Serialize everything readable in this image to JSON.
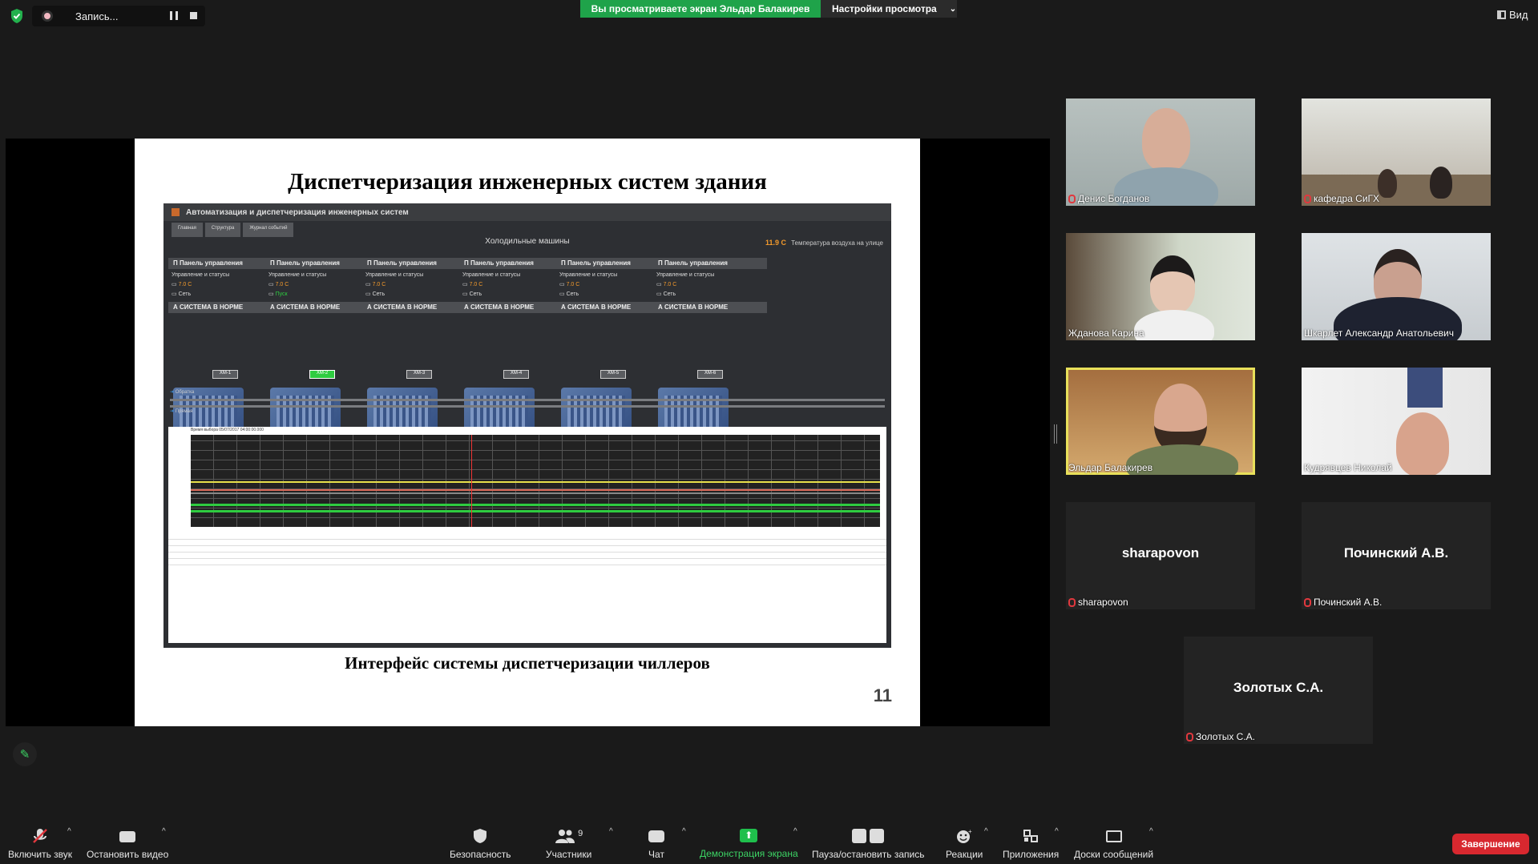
{
  "topbar": {
    "recording_label": "Запись...",
    "viewing_banner": "Вы просматриваете экран Эльдар Балакирев",
    "view_settings_label": "Настройки просмотра",
    "view_button_label": "Вид"
  },
  "slide": {
    "title": "Диспетчеризация инженерных систем здания",
    "caption": "Интерфейс системы диспетчеризации чиллеров",
    "page_number": "11",
    "scada": {
      "app_title": "Автоматизация и диспетчеризация инженерных систем",
      "tabs": [
        "Главная",
        "Структура",
        "Журнал событий"
      ],
      "section_title": "Холодильные машины",
      "outdoor_temp": "11.9 C",
      "outdoor_temp_label": "Температура воздуха на улице",
      "chillers": [
        {
          "panel": "П  Панель управления",
          "status_head": "Управление и статусы",
          "setpoint": "7.0 C",
          "status": "Сеть",
          "norm": "А  СИСТЕМА В НОРМЕ",
          "id": "ХМ-1"
        },
        {
          "panel": "П  Панель управления",
          "status_head": "Управление и статусы",
          "setpoint": "7.0 C",
          "status": "Пуск",
          "norm": "А  СИСТЕМА В НОРМЕ",
          "id": "ХМ-2"
        },
        {
          "panel": "П  Панель управления",
          "status_head": "Управление и статусы",
          "setpoint": "7.0 C",
          "status": "Сеть",
          "norm": "А  СИСТЕМА В НОРМЕ",
          "id": "ХМ-3"
        },
        {
          "panel": "П  Панель управления",
          "status_head": "Управление и статусы",
          "setpoint": "7.0 C",
          "status": "Сеть",
          "norm": "А  СИСТЕМА В НОРМЕ",
          "id": "ХМ-4"
        },
        {
          "panel": "П  Панель управления",
          "status_head": "Управление и статусы",
          "setpoint": "7.0 C",
          "status": "Сеть",
          "norm": "А  СИСТЕМА В НОРМЕ",
          "id": "ХМ-5"
        },
        {
          "panel": "П  Панель управления",
          "status_head": "Управление и статусы",
          "setpoint": "7.0 C",
          "status": "Сеть",
          "norm": "А  СИСТЕМА В НОРМЕ",
          "id": "ХМ-6"
        }
      ],
      "return_label": "Обратка",
      "supply_label": "Прямая",
      "chart_time_label": "Время выбора 05/07/2017 04:00:00.000"
    }
  },
  "participants": [
    {
      "name": "Денис Богданов",
      "muted": true,
      "video": true
    },
    {
      "name": "кафедра СиГХ",
      "muted": true,
      "video": true
    },
    {
      "name": "Жданова Карина",
      "muted": false,
      "video": true
    },
    {
      "name": "Шкарлет Александр Анатольевич",
      "muted": false,
      "video": true
    },
    {
      "name": "Эльдар Балакирев",
      "muted": false,
      "video": true,
      "speaking": true
    },
    {
      "name": "Кудрявцев Николай",
      "muted": false,
      "video": true
    },
    {
      "name": "sharapovon",
      "muted": true,
      "video": false
    },
    {
      "name": "Починский А.В.",
      "muted": true,
      "video": false
    },
    {
      "name": "Золотых С.А.",
      "muted": true,
      "video": false
    }
  ],
  "toolbar": {
    "unmute": "Включить звук",
    "stop_video": "Остановить видео",
    "security": "Безопасность",
    "participants": "Участники",
    "participants_count": "9",
    "chat": "Чат",
    "share_screen": "Демонстрация экрана",
    "pause_recording": "Пауза/остановить запись",
    "reactions": "Реакции",
    "apps": "Приложения",
    "whiteboards": "Доски сообщений",
    "end": "Завершение"
  },
  "colors": {
    "viewing_banner": "#1fa34a",
    "share_icon": "#1fbf4c",
    "end_button": "#d8282f",
    "speaker_outline": "#e8e05a",
    "mute_icon": "#e0383e"
  }
}
